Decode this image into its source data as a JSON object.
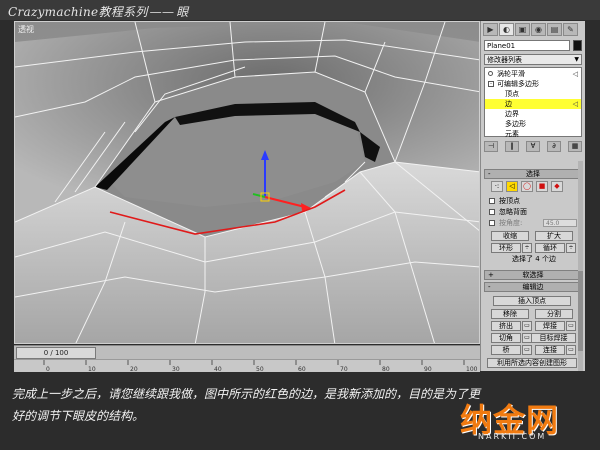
{
  "header": {
    "brand": "Crazymachine",
    "series": "教程系列",
    "dash": "——",
    "topic": "眼"
  },
  "viewport": {
    "label": "透视"
  },
  "timeline": {
    "frame": "0 / 100",
    "ticks": [
      "0",
      "10",
      "20",
      "30",
      "40",
      "50",
      "60",
      "70",
      "80",
      "90",
      "100"
    ]
  },
  "panel": {
    "tabs": [
      "▶",
      "◐",
      "▣",
      "◉",
      "▤",
      "✎"
    ],
    "object_name": "Plane01",
    "object_color": "#111111",
    "modifier_list": "修改器列表",
    "stack": [
      {
        "label": "涡轮平滑",
        "icon": "bulb",
        "tail": "◁",
        "child": false,
        "selected": false
      },
      {
        "label": "可编辑多边形",
        "icon": "box",
        "tail": "",
        "child": false,
        "selected": false
      },
      {
        "label": "顶点",
        "icon": "",
        "tail": "",
        "child": true,
        "selected": false
      },
      {
        "label": "边",
        "icon": "",
        "tail": "◁",
        "child": true,
        "selected": true
      },
      {
        "label": "边界",
        "icon": "",
        "tail": "",
        "child": true,
        "selected": false
      },
      {
        "label": "多边形",
        "icon": "",
        "tail": "",
        "child": true,
        "selected": false
      },
      {
        "label": "元素",
        "icon": "",
        "tail": "",
        "child": true,
        "selected": false
      }
    ],
    "tools": [
      "⊣",
      "‖",
      "∀",
      "∂",
      "▦"
    ],
    "selection_rollout": "选择",
    "sel_icons": [
      "·:",
      "◁",
      "◯",
      "■",
      "◆"
    ],
    "by_vertex": "按顶点",
    "ignore_backfacing": "忽略背面",
    "by_angle": "按角度:",
    "angle_value": "45.0",
    "shrink": "收缩",
    "grow": "扩大",
    "ring": "环形",
    "loop": "循环",
    "status_text": "选择了 4 个边",
    "soft_selection": "软选择",
    "edit_edges": "编辑边",
    "insert_vertex": "插入顶点",
    "remove": "移除",
    "split": "分割",
    "extrude": "挤出",
    "weld": "焊接",
    "chamfer": "切角",
    "target_weld": "目标焊接",
    "bridge": "桥",
    "connect": "连接",
    "create_shape": "利用所选内容创建图形"
  },
  "caption": {
    "line1": "完成上一步之后，请您继续跟我做，图中所示的红色的边，是我新添加的，目的是为了更",
    "line2": "好的调节下眼皮的结构。"
  },
  "watermark": {
    "text": "纳金网",
    "sub": "NARKII.COM"
  }
}
